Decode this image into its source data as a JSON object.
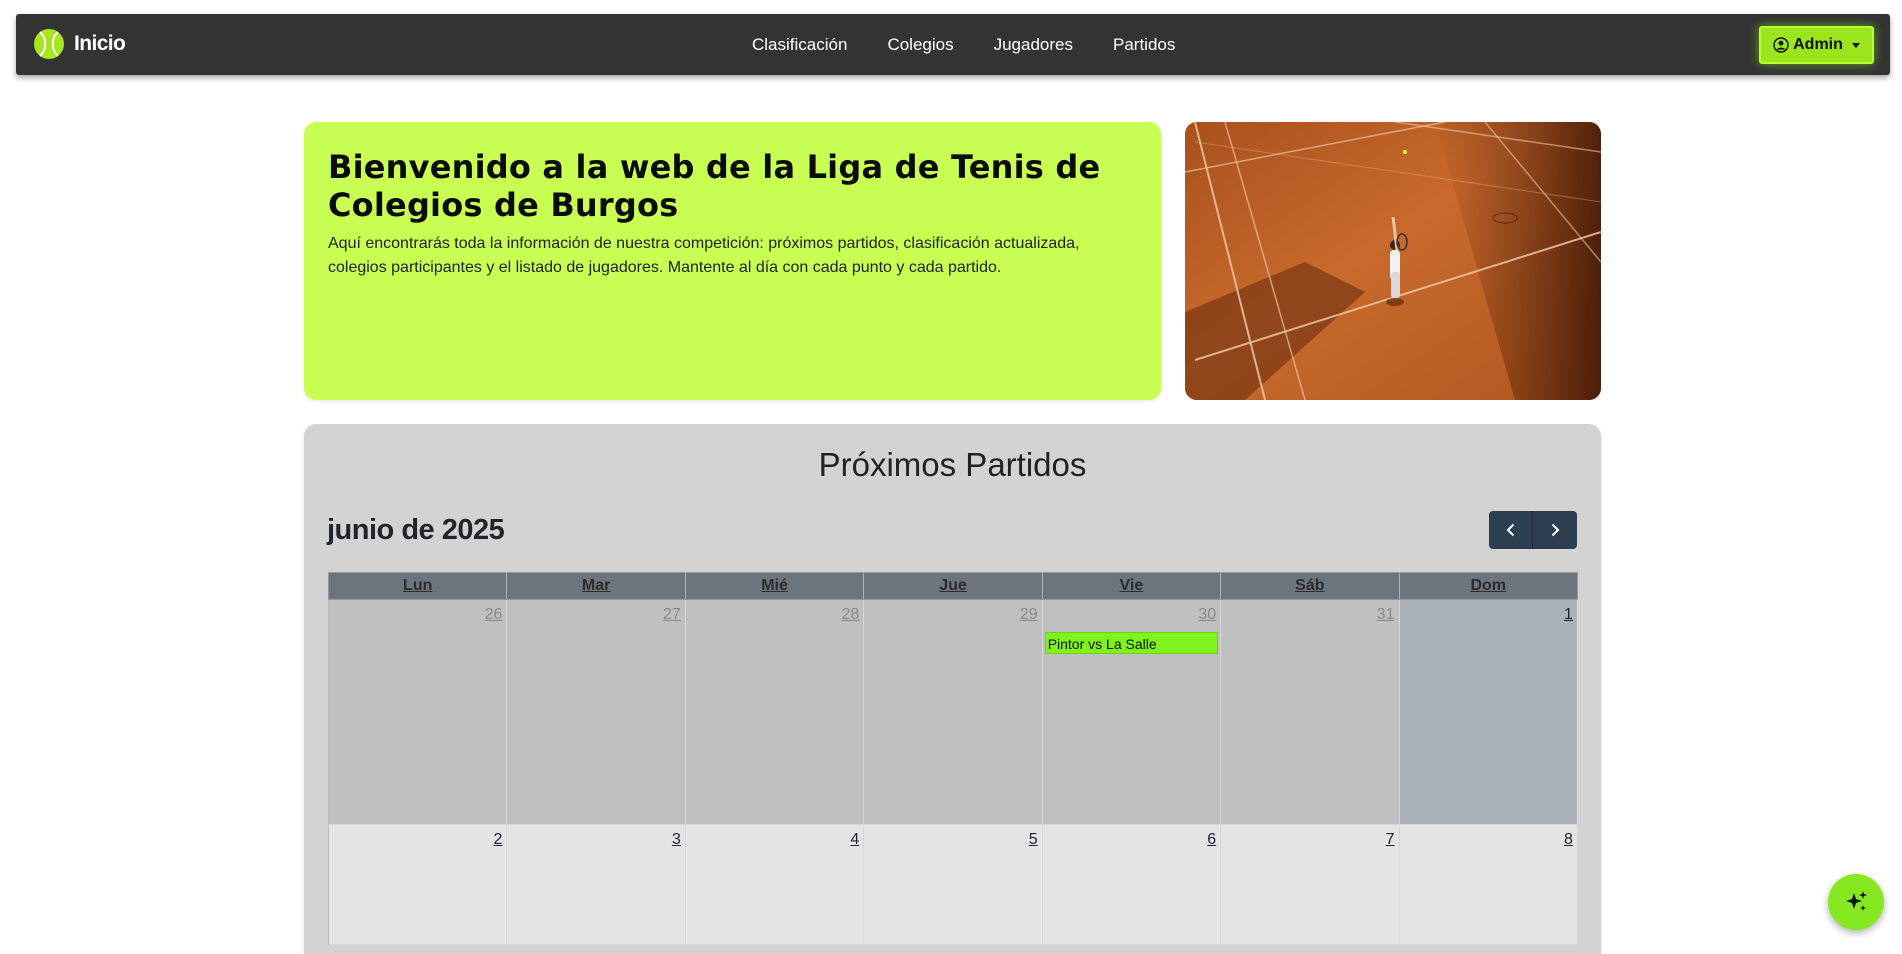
{
  "navbar": {
    "brand": "Inicio",
    "links": [
      "Clasificación",
      "Colegios",
      "Jugadores",
      "Partidos"
    ],
    "admin_label": "Admin",
    "accent": "#9be51c"
  },
  "hero": {
    "title": "Bienvenido a la web de la Liga de Tenis de Colegios de Burgos",
    "text": "Aquí encontrarás toda la información de nuestra competición: próximos partidos, clasificación actualizada, colegios participantes y el listado de jugadores. Mantente al día con cada punto y cada partido.",
    "image_icon": "tennis-court-photo"
  },
  "calendar": {
    "section_title": "Próximos Partidos",
    "month_label": "junio de 2025",
    "weekdays": [
      "Lun",
      "Mar",
      "Mié",
      "Jue",
      "Vie",
      "Sáb",
      "Dom"
    ],
    "weeks": [
      [
        {
          "day": "26",
          "current": false,
          "event": null
        },
        {
          "day": "27",
          "current": false,
          "event": null
        },
        {
          "day": "28",
          "current": false,
          "event": null
        },
        {
          "day": "29",
          "current": false,
          "event": null
        },
        {
          "day": "30",
          "current": false,
          "event": "Pintor vs La Salle"
        },
        {
          "day": "31",
          "current": false,
          "event": null
        },
        {
          "day": "1",
          "current": true,
          "today": true,
          "event": null
        }
      ],
      [
        {
          "day": "2",
          "current": true,
          "event": null
        },
        {
          "day": "3",
          "current": true,
          "event": null
        },
        {
          "day": "4",
          "current": true,
          "event": null
        },
        {
          "day": "5",
          "current": true,
          "event": null
        },
        {
          "day": "6",
          "current": true,
          "event": null
        },
        {
          "day": "7",
          "current": true,
          "event": null
        },
        {
          "day": "8",
          "current": true,
          "event": null
        }
      ]
    ],
    "event_color": "#80f21c",
    "prev_icon": "chevron-left-icon",
    "next_icon": "chevron-right-icon"
  },
  "fab": {
    "icon": "sparkles-icon"
  }
}
